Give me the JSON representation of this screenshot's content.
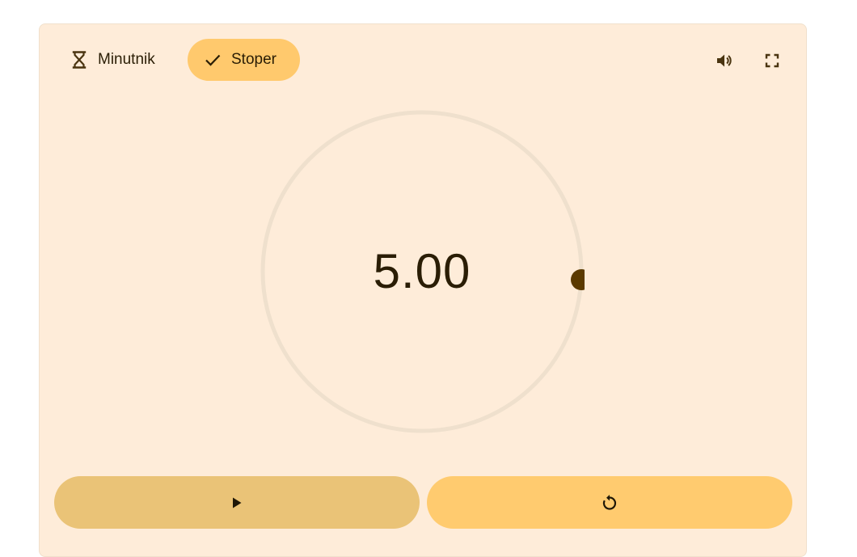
{
  "mode_tabs": {
    "timer_label": "Minutnik",
    "stopwatch_label": "Stoper",
    "active": "stopwatch"
  },
  "toolbar": {
    "sound_icon": "volume-icon",
    "fullscreen_icon": "fullscreen-icon"
  },
  "display": {
    "time": "5.00"
  },
  "controls": {
    "play_icon": "play-icon",
    "reset_icon": "reset-icon"
  },
  "colors": {
    "card_background": "#feecd9",
    "active_chip": "#ffc96d",
    "play_button": "#eac377",
    "reset_button": "#ffcb6f",
    "dial_track": "#efe0cd",
    "progress_dot": "#5b3a00",
    "text": "#2a1d05"
  }
}
